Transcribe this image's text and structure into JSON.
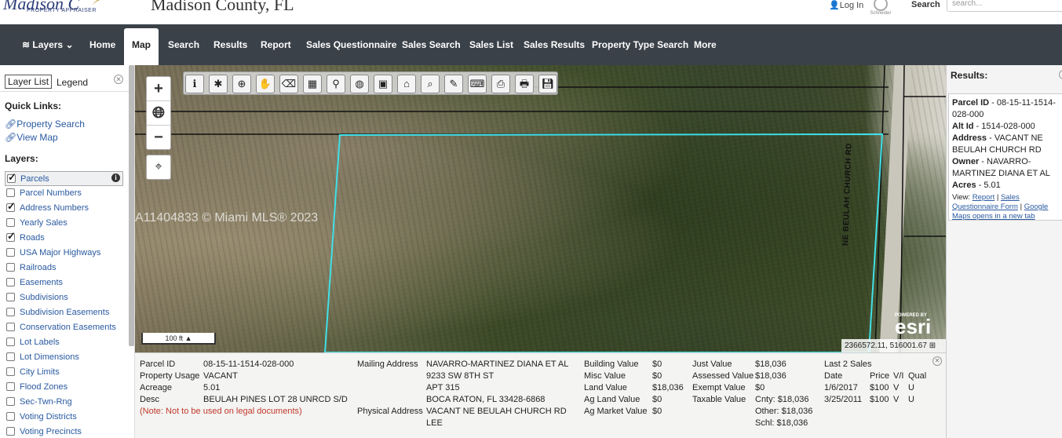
{
  "header": {
    "logo_text": "Madison C",
    "logo_sub": "PROPERTY APPRAISER",
    "county_title": "Madison County, FL",
    "login": "Log In",
    "schneider": "Schneider",
    "search_label": "Search",
    "search_placeholder": "search..."
  },
  "nav": {
    "layers": "Layers",
    "home": "Home",
    "map": "Map",
    "search": "Search",
    "results": "Results",
    "report": "Report",
    "sales_questionnaire": "Sales Questionnaire",
    "sales_search": "Sales Search",
    "sales_list": "Sales List",
    "sales_results": "Sales Results",
    "property_type_search": "Property Type Search",
    "more": "More"
  },
  "sidebar": {
    "tab_layer_list": "Layer List",
    "tab_legend": "Legend",
    "quick_links_heading": "Quick Links:",
    "link_property_search": "Property Search",
    "link_view_map": "View Map",
    "layers_heading": "Layers:",
    "layers": [
      {
        "label": "Parcels",
        "checked": true
      },
      {
        "label": "Parcel Numbers",
        "checked": false
      },
      {
        "label": "Address Numbers",
        "checked": true
      },
      {
        "label": "Yearly Sales",
        "checked": false
      },
      {
        "label": "Roads",
        "checked": true
      },
      {
        "label": "USA Major Highways",
        "checked": false
      },
      {
        "label": "Railroads",
        "checked": false
      },
      {
        "label": "Easements",
        "checked": false
      },
      {
        "label": "Subdivisions",
        "checked": false
      },
      {
        "label": "Subdivision Easements",
        "checked": false
      },
      {
        "label": "Conservation Easements",
        "checked": false
      },
      {
        "label": "Lot Labels",
        "checked": false
      },
      {
        "label": "Lot Dimensions",
        "checked": false
      },
      {
        "label": "City Limits",
        "checked": false
      },
      {
        "label": "Flood Zones",
        "checked": false
      },
      {
        "label": "Sec-Twn-Rng",
        "checked": false
      },
      {
        "label": "Voting Districts",
        "checked": false
      },
      {
        "label": "Voting Precincts",
        "checked": false
      }
    ]
  },
  "map": {
    "road_label": "NE BEULAH CHURCH RD",
    "scale": "100 ft",
    "esri_powered": "POWERED BY",
    "esri": "esri",
    "coords": "2366572.11, 516001.67",
    "watermark": "A11404833 © Miami MLS® 2023"
  },
  "results": {
    "title": "Results:",
    "parcel_id_label": "Parcel ID",
    "parcel_id": "08-15-11-1514-028-000",
    "alt_id_label": "Alt Id",
    "alt_id": "1514-028-000",
    "address_label": "Address",
    "address": "VACANT NE BEULAH CHURCH RD",
    "owner_label": "Owner",
    "owner": "NAVARRO-MARTINEZ DIANA ET AL",
    "acres_label": "Acres",
    "acres": "5.01",
    "view_label": "View:",
    "link_report": "Report",
    "link_sales_q": "Sales Questionnaire Form",
    "link_google": "Google Maps opens in a new tab"
  },
  "info": {
    "parcel_id_label": "Parcel ID",
    "parcel_id": "08-15-11-1514-028-000",
    "property_usage_label": "Property Usage",
    "property_usage": "VACANT",
    "acreage_label": "Acreage",
    "acreage": "5.01",
    "desc_label": "Desc",
    "desc": "BEULAH PINES LOT 28 UNRCD S/D",
    "note": "(Note: Not to be used on legal documents)",
    "mailing_label": "Mailing Address",
    "mailing_1": "NAVARRO-MARTINEZ DIANA ET AL",
    "mailing_2": "9233 SW 8TH ST",
    "mailing_3": "APT 315",
    "mailing_4": "BOCA RATON, FL 33428-6868",
    "physical_label": "Physical Address",
    "physical_1": "VACANT NE BEULAH CHURCH RD",
    "physical_2": "LEE",
    "building_value_label": "Building Value",
    "building_value": "$0",
    "misc_value_label": "Misc Value",
    "misc_value": "$0",
    "land_value_label": "Land Value",
    "land_value": "$18,036",
    "ag_land_value_label": "Ag Land Value",
    "ag_land_value": "$0",
    "ag_market_value_label": "Ag Market Value",
    "ag_market_value": "$0",
    "just_value_label": "Just Value",
    "just_value": "$18,036",
    "assessed_value_label": "Assessed Value",
    "assessed_value": "$18,036",
    "exempt_value_label": "Exempt Value",
    "exempt_value": "$0",
    "taxable_value_label": "Taxable Value",
    "taxable_cnty": "Cnty: $18,036",
    "taxable_other": "Other: $18,036",
    "taxable_schl": "Schl: $18,036",
    "last_sales_label": "Last 2 Sales",
    "sales_headers": [
      "Date",
      "Price",
      "V/I",
      "Qual"
    ],
    "sales": [
      {
        "date": "1/6/2017",
        "price": "$100",
        "vi": "V",
        "qual": "U"
      },
      {
        "date": "3/25/2011",
        "price": "$100",
        "vi": "V",
        "qual": "U"
      }
    ]
  }
}
